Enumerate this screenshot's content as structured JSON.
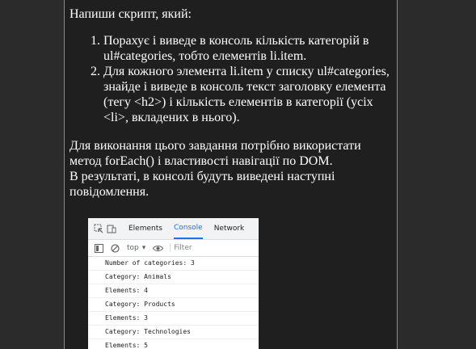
{
  "task": {
    "intro": "Напиши скрипт, який:",
    "items": [
      "Порахує і виведе в консоль кількість категорій в ul#categories, тобто елементів li.item.",
      "Для кожного элемента li.item у списку ul#categories, знайде і виведе в консоль текст заголовку елемента (тегу <h2>) і кількість елементів в категорії (усіх <li>, вкладених в нього)."
    ],
    "after_line1": "Для виконання цього завдання потрібно використати метод forEach() і властивості навігації по DOM.",
    "after_line2": "В результаті, в консолі будуть виведені наступні повідомлення."
  },
  "devtools": {
    "tabs": [
      "Elements",
      "Console",
      "Network"
    ],
    "active_tab": "Console",
    "context_select": "top",
    "filter_placeholder": "Filter",
    "icons": [
      "inspect-icon",
      "device-toggle-icon",
      "sidebar-icon",
      "clear-console-icon",
      "eye-icon"
    ],
    "log_lines": [
      "Number of categories: 3",
      "Category: Animals",
      "Elements: 4",
      "Category: Products",
      "Elements: 3",
      "Category: Technologies",
      "Elements: 5"
    ],
    "accent_color": "#1a73e8"
  }
}
